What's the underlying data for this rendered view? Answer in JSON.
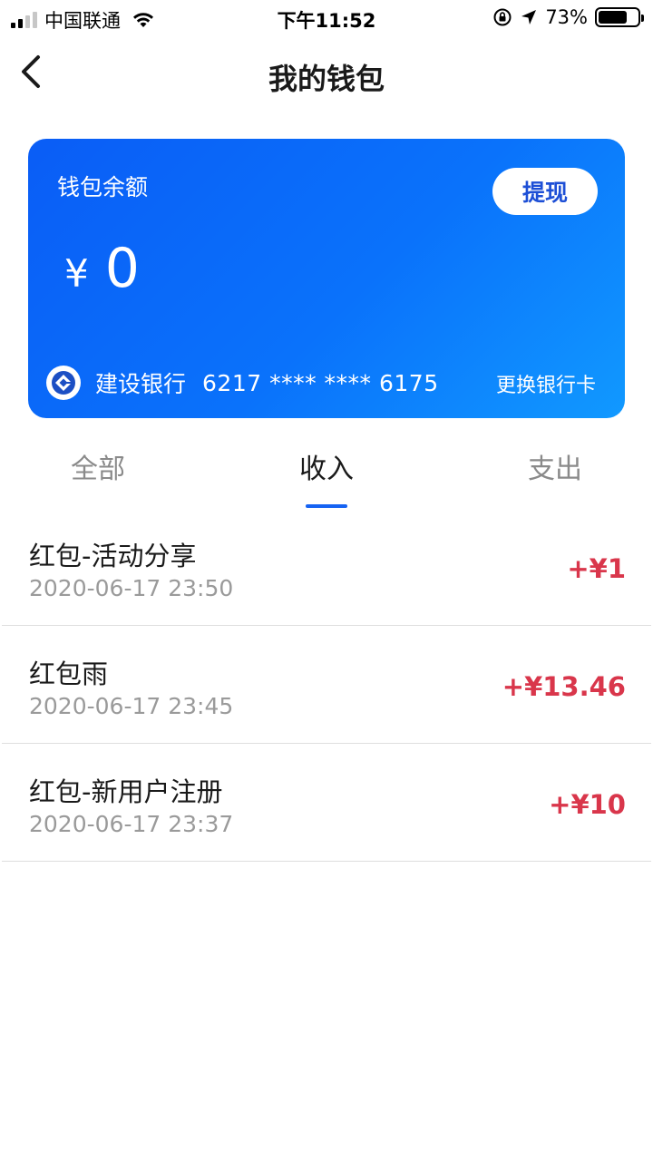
{
  "status_bar": {
    "carrier": "中国联通",
    "time": "下午11:52",
    "battery": "73%",
    "battery_level": 0.73
  },
  "nav": {
    "title": "我的钱包",
    "back_icon": "chevron-left-icon"
  },
  "wallet_card": {
    "label": "钱包余额",
    "withdraw_label": "提现",
    "currency": "¥",
    "balance": "0",
    "bank_name": "建设银行",
    "card_number": "6217 **** **** 6175",
    "change_card_label": "更换银行卡",
    "gradient_start": "#0a5df6",
    "gradient_end": "#1199ff"
  },
  "tabs": [
    {
      "label": "全部",
      "active": false
    },
    {
      "label": "收入",
      "active": true
    },
    {
      "label": "支出",
      "active": false
    }
  ],
  "transactions": [
    {
      "title": "红包-活动分享",
      "time": "2020-06-17 23:50",
      "amount": "+¥1"
    },
    {
      "title": "红包雨",
      "time": "2020-06-17 23:45",
      "amount": "+¥13.46"
    },
    {
      "title": "红包-新用户注册",
      "time": "2020-06-17 23:37",
      "amount": "+¥10"
    }
  ],
  "colors": {
    "accent": "#1663f3",
    "income": "#d9364b"
  }
}
